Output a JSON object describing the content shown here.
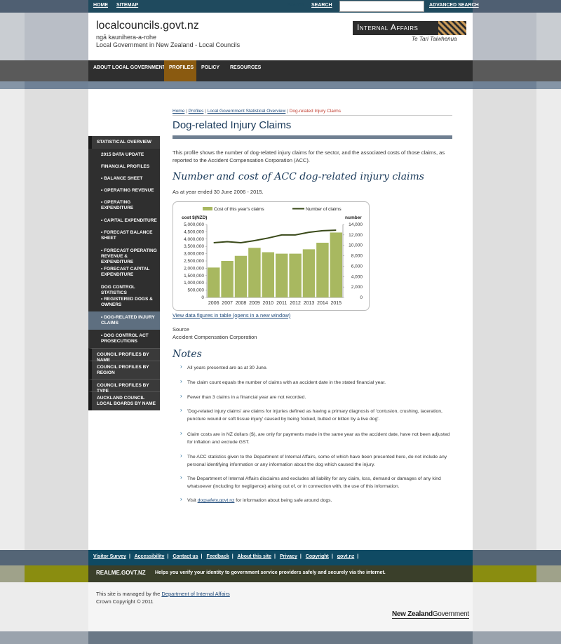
{
  "topbar": {
    "home": "HOME",
    "sitemap": "SITEMAP",
    "search_label": "Search",
    "search_button": "SEARCH",
    "search_value": "",
    "advanced": "ADVANCED SEARCH"
  },
  "header": {
    "title": "localcouncils.govt.nz",
    "sub1": "ngā kaunihera-a-rohe",
    "sub2": "Local Government in New Zealand - Local Councils",
    "logo_text": "Internal Affairs",
    "logo_tag": "Te Tari Taiwhenua"
  },
  "nav": {
    "items": [
      "ABOUT LOCAL GOVERNMENT",
      "PROFILES",
      "POLICY",
      "RESOURCES"
    ]
  },
  "sidebar": {
    "items": [
      "STATISTICAL OVERVIEW",
      "2015 DATA UPDATE",
      "FINANCIAL PROFILES",
      "• BALANCE SHEET",
      "• OPERATING REVENUE",
      "• OPERATING EXPENDITURE",
      "• CAPITAL EXPENDITURE",
      "• FORECAST BALANCE SHEET",
      "• FORECAST OPERATING REVENUE & EXPENDITURE",
      "• FORECAST CAPITAL EXPENDITURE",
      "DOG CONTROL STATISTICS",
      "• REGISTERED DOGS & OWNERS",
      "• DOG-RELATED INJURY CLAIMS",
      "• DOG CONTROL ACT PROSECUTIONS",
      "COUNCIL PROFILES BY NAME",
      "COUNCIL PROFILES BY REGION",
      "COUNCIL PROFILES BY TYPE",
      "AUCKLAND COUNCIL LOCAL BOARDS BY NAME"
    ]
  },
  "breadcrumb": {
    "home": "Home",
    "profiles": "Profiles",
    "overview": "Local Government Statistical Overview",
    "current": "Dog-related Injury Claims",
    "sep": "|"
  },
  "main": {
    "title": "Dog-related Injury Claims",
    "intro": "This profile shows the number of dog-related injury claims for the sector, and the associated costs of those claims, as reported to the Accident Compensation Corporation (ACC).",
    "subtitle": "Number and cost of ACC dog-related injury claims",
    "as_at": "As at year ended 30 June 2006 - 2015.",
    "view_link": "View data figures in table (opens in a new window)",
    "source_label": "Source",
    "source_value": "Accident Compensation Corporation",
    "notes_title": "Notes",
    "notes": [
      "All years presented are as at 30 June.",
      "The claim count equals the number of claims with an accident date in the stated financial year.",
      "Fewer than 3 claims in a financial year are not recorded.",
      "'Dog-related injury claims' are claims for injuries defined as having a primary diagnosis of 'contusion, crushing, laceration, puncture wound or soft tissue injury' caused by being 'kicked, butted or bitten by a live dog'.",
      "Claim costs are in NZ dollars ($), are only for payments made in the same year as the accident date, have not been adjusted for inflation and exclude GST.",
      "The ACC statistics given to the Department of Internal Affairs, some of which have been presented here, do not include any personal identifying information or any information about the dog which caused the injury.",
      "The Department of Internal Affairs disclaims and excludes all liability for any claim, loss, demand or damages of any kind whatsoever (including for negligence) arising out of, or in connection with, the use of this information."
    ],
    "last_note_pre": "Visit ",
    "last_note_link": "dogsafety.govt.nz",
    "last_note_post": " for information about being safe around dogs."
  },
  "chart_data": {
    "type": "bar",
    "categories": [
      "2006",
      "2007",
      "2008",
      "2009",
      "2010",
      "2011",
      "2012",
      "2013",
      "2014",
      "2015"
    ],
    "series": [
      {
        "name": "Cost of this year's claims",
        "type": "bar",
        "axis": "left",
        "color": "#a8b860",
        "values": [
          2050000,
          2500000,
          2850000,
          3400000,
          3100000,
          3000000,
          3000000,
          3300000,
          3750000,
          4450000
        ]
      },
      {
        "name": "Number of claims",
        "type": "line",
        "axis": "right",
        "color": "#3a4a1a",
        "values": [
          10500,
          10700,
          10500,
          10900,
          11400,
          12000,
          12000,
          12500,
          12800,
          12900
        ]
      }
    ],
    "ylabel_left": "cost $(NZD)",
    "ylabel_right": "number",
    "ylim_left": [
      0,
      5000000
    ],
    "ylim_right": [
      0,
      14000
    ],
    "yticks_left": [
      "5,000,000",
      "4,500,000",
      "4,000,000",
      "3,500,000",
      "3,000,000",
      "2,500,000",
      "2,000,000",
      "1,500,000",
      "1,000,000",
      "500,000",
      "0"
    ],
    "yticks_right": [
      "14,000",
      "12,000",
      "10,000",
      "8,000",
      "6,000",
      "4,000",
      "2,000",
      "0"
    ],
    "legend": "top"
  },
  "footer": {
    "links": [
      "Visitor Survey",
      "Accessibility",
      "Contact us",
      "Feedback",
      "About this site",
      "Privacy",
      "Copyright",
      "govt.nz"
    ],
    "realme": "REALME.GOVT.NZ",
    "realme_desc": "Helps you verify your identity to government service providers safely and securely via the internet.",
    "managed_pre": "This site is managed by the ",
    "managed_link": "Department of Internal Affairs",
    "copyright": "Crown Copyright © 2011",
    "nzgov_a": "New Zealand",
    "nzgov_b": "Government"
  }
}
